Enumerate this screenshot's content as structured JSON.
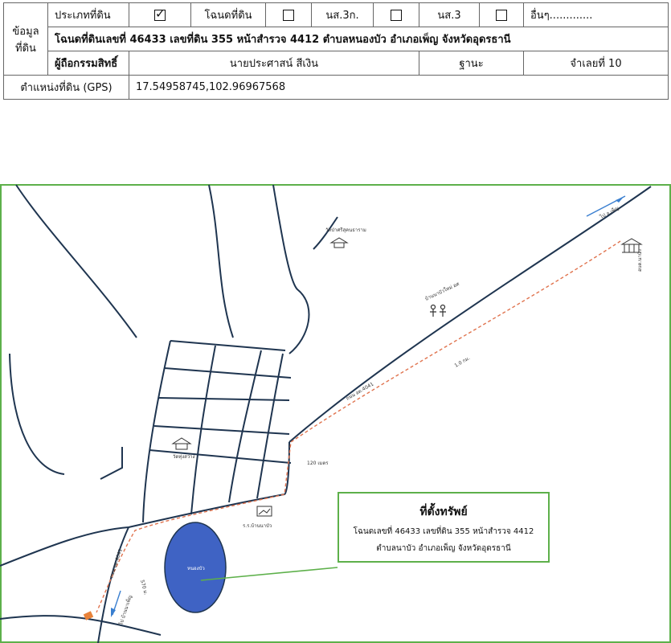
{
  "table": {
    "group_label_1": "ข้อมูล",
    "group_label_2": "ที่ดิน",
    "land_type_label": "ประเภทที่ดิน",
    "opt_chanote": "โฉนดที่ดิน",
    "opt_ns3k": "นส.3ก.",
    "opt_ns3": "นส.3",
    "opt_other": "อื่นๆ.............",
    "title_deed_line": "โฉนดที่ดินเลขที่ 46433 เลขที่ดิน 355 หน้าสำรวจ 4412 ตำบลหนองบัว อำเภอเพ็ญ จังหวัดอุดรธานี",
    "owner_label": "ผู้ถือกรรมสิทธิ์",
    "owner_name": "นายประศาสน์ สีเงิน",
    "status_label": "ฐานะ",
    "status_value": "จำเลยที่ 10",
    "gps_label": "ตำแหน่งที่ดิน (GPS)",
    "gps_value": "17.54958745,102.96967568"
  },
  "checkboxes": {
    "chanote": true,
    "ns3k": false,
    "ns3": false,
    "other": false
  },
  "map": {
    "callout_title": "ที่ตั้งทรัพย์",
    "callout_line1": "โฉนดเลขที่ 46433 เลขที่ดิน 355 หน้าสำรวจ 4412",
    "callout_line2": "ตำบลนาบัว อำเภอเพ็ญ จังหวัดอุดรธานี",
    "label_temple_top": "วัดป่าศรีสุคนธาราม",
    "label_direction_top": "ไป อ.เพ็ญ",
    "label_office": "อบต.นาบัว",
    "label_village": "บ้านนาบัวใหม่ อศ",
    "label_road_1": "ถนน อด.4041",
    "label_dist_1": "1.0 กม.",
    "label_dist_120": "120 เมตร",
    "label_temple_mid": "วัดทุ่งสว่าง",
    "label_school": "ร.ร.บ้านนาบัว",
    "label_pond": "หนองบัว",
    "label_road_2": "ถนน อด.4041",
    "label_dist_570": "570 ม.",
    "label_direction_bottom": "ไป บ้านนาเพ็ญ",
    "colors": {
      "frame": "#5db04a",
      "pond": "#3f63c4",
      "road": "#1f3550",
      "route": "#e0734e",
      "arrow": "#3a7fd0",
      "site": "#e8823a"
    }
  }
}
